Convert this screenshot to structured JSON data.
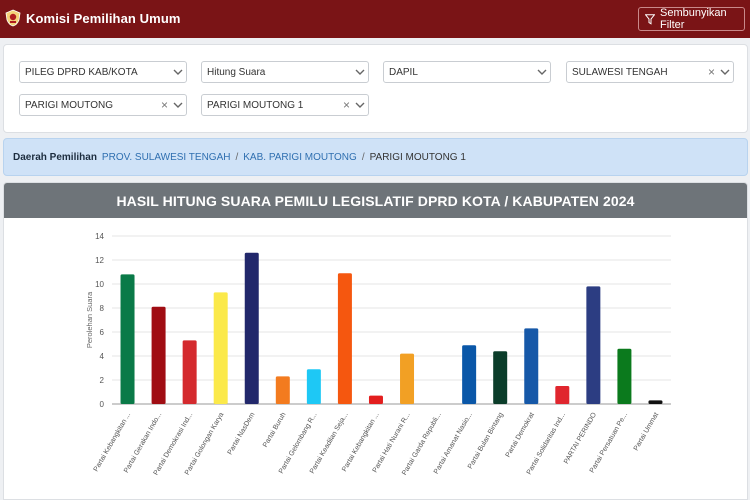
{
  "app": {
    "title": "Komisi Pemilihan Umum",
    "logo": "kpu-logo",
    "brand_color": "#7a1416"
  },
  "header": {
    "filter_button_label": "Sembunyikan Filter",
    "filter_icon": "funnel-icon"
  },
  "filters": {
    "election": {
      "value": "PILEG DPRD KAB/KOTA"
    },
    "count_type": {
      "value": "Hitung Suara"
    },
    "level": {
      "value": "DAPIL"
    },
    "province": {
      "value": "SULAWESI TENGAH"
    },
    "regency": {
      "value": "PARIGI MOUTONG"
    },
    "dapil": {
      "value": "PARIGI MOUTONG 1"
    }
  },
  "breadcrumb": {
    "label": "Daerah Pemilihan",
    "items": [
      "PROV. SULAWESI TENGAH",
      "KAB. PARIGI MOUTONG"
    ],
    "separator": "/",
    "current": "PARIGI MOUTONG 1"
  },
  "card": {
    "title": "HASIL HITUNG SUARA PEMILU LEGISLATIF DPRD KOTA / KABUPATEN 2024"
  },
  "chart_data": {
    "type": "bar",
    "ylabel": "Perolehan Suara",
    "ylim": [
      0,
      14
    ],
    "yticks": [
      0,
      2,
      4,
      6,
      8,
      10,
      12,
      14
    ],
    "grid": true,
    "categories": [
      "Partai Kebangkitan ...",
      "Partai Gerakan Indo...",
      "Partai Demokrasi Ind...",
      "Partai Golongan Karya",
      "Partai NasDem",
      "Partai Buruh",
      "Partai Gelombang R...",
      "Partai Keadilan Seja...",
      "Partai Kebangkitan ...",
      "Partai Hati Nurani R...",
      "Partai Garda Republi...",
      "Partai Amanat Nasio...",
      "Partai Bulan Bintang",
      "Partai Demokrat",
      "Partai Solidaritas Ind...",
      "PARTAI PERINDO",
      "Partai Persatuan Pe...",
      "Partai Ummat"
    ],
    "values": [
      10.8,
      8.1,
      5.3,
      9.3,
      12.6,
      2.3,
      2.9,
      10.9,
      0.7,
      4.2,
      0,
      4.9,
      4.4,
      6.3,
      1.5,
      9.8,
      4.6,
      0.3
    ],
    "colors": [
      "#0a7a48",
      "#a00d13",
      "#d42a2e",
      "#fbe94a",
      "#22286b",
      "#f37b1f",
      "#1ec8f5",
      "#f5570f",
      "#e31e1e",
      "#f2a024",
      "#d0a52c",
      "#0a57a8",
      "#0b3d2a",
      "#1658a8",
      "#e0262e",
      "#2c3d82",
      "#0b7a1d",
      "#111111"
    ]
  }
}
